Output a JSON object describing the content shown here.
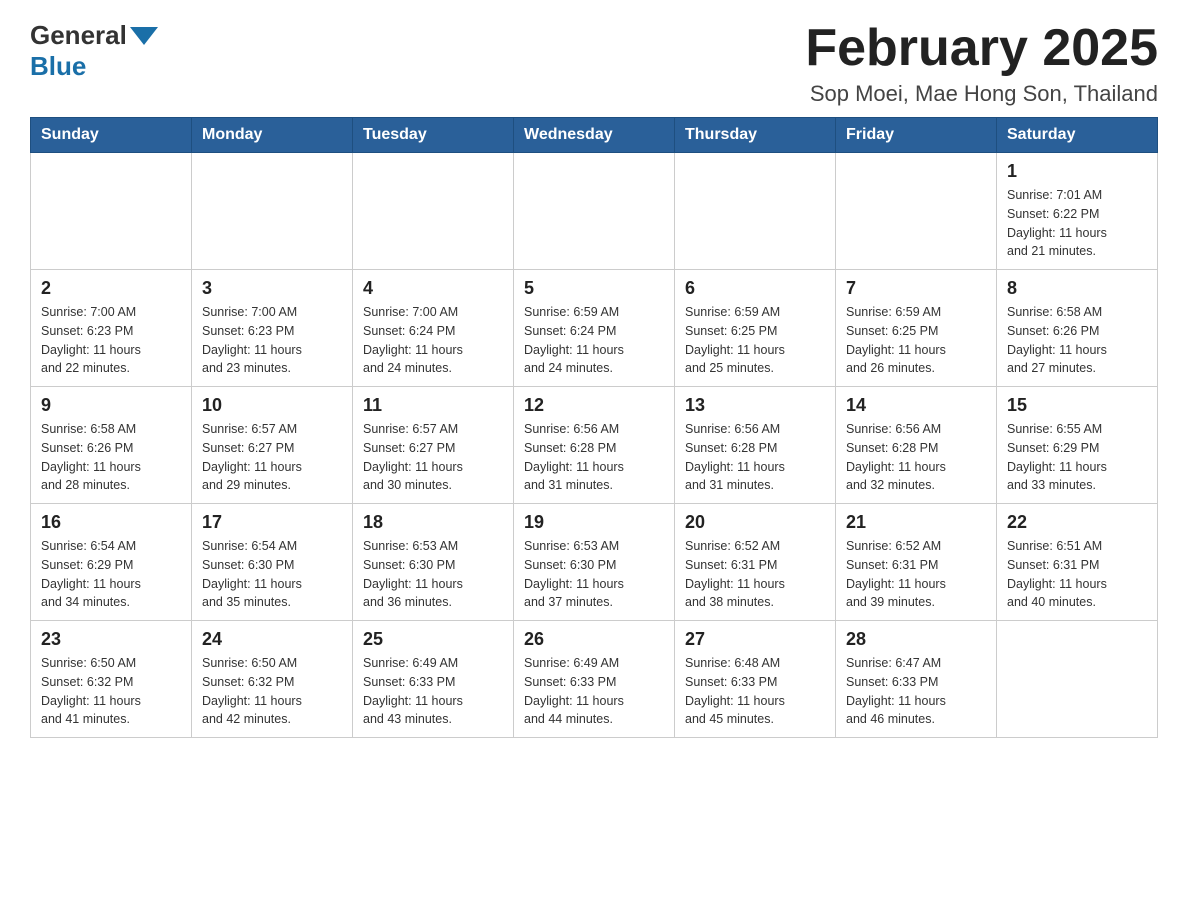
{
  "header": {
    "logo_general": "General",
    "logo_blue": "Blue",
    "month_title": "February 2025",
    "location": "Sop Moei, Mae Hong Son, Thailand"
  },
  "weekdays": [
    "Sunday",
    "Monday",
    "Tuesday",
    "Wednesday",
    "Thursday",
    "Friday",
    "Saturday"
  ],
  "weeks": [
    [
      {
        "day": "",
        "info": ""
      },
      {
        "day": "",
        "info": ""
      },
      {
        "day": "",
        "info": ""
      },
      {
        "day": "",
        "info": ""
      },
      {
        "day": "",
        "info": ""
      },
      {
        "day": "",
        "info": ""
      },
      {
        "day": "1",
        "info": "Sunrise: 7:01 AM\nSunset: 6:22 PM\nDaylight: 11 hours\nand 21 minutes."
      }
    ],
    [
      {
        "day": "2",
        "info": "Sunrise: 7:00 AM\nSunset: 6:23 PM\nDaylight: 11 hours\nand 22 minutes."
      },
      {
        "day": "3",
        "info": "Sunrise: 7:00 AM\nSunset: 6:23 PM\nDaylight: 11 hours\nand 23 minutes."
      },
      {
        "day": "4",
        "info": "Sunrise: 7:00 AM\nSunset: 6:24 PM\nDaylight: 11 hours\nand 24 minutes."
      },
      {
        "day": "5",
        "info": "Sunrise: 6:59 AM\nSunset: 6:24 PM\nDaylight: 11 hours\nand 24 minutes."
      },
      {
        "day": "6",
        "info": "Sunrise: 6:59 AM\nSunset: 6:25 PM\nDaylight: 11 hours\nand 25 minutes."
      },
      {
        "day": "7",
        "info": "Sunrise: 6:59 AM\nSunset: 6:25 PM\nDaylight: 11 hours\nand 26 minutes."
      },
      {
        "day": "8",
        "info": "Sunrise: 6:58 AM\nSunset: 6:26 PM\nDaylight: 11 hours\nand 27 minutes."
      }
    ],
    [
      {
        "day": "9",
        "info": "Sunrise: 6:58 AM\nSunset: 6:26 PM\nDaylight: 11 hours\nand 28 minutes."
      },
      {
        "day": "10",
        "info": "Sunrise: 6:57 AM\nSunset: 6:27 PM\nDaylight: 11 hours\nand 29 minutes."
      },
      {
        "day": "11",
        "info": "Sunrise: 6:57 AM\nSunset: 6:27 PM\nDaylight: 11 hours\nand 30 minutes."
      },
      {
        "day": "12",
        "info": "Sunrise: 6:56 AM\nSunset: 6:28 PM\nDaylight: 11 hours\nand 31 minutes."
      },
      {
        "day": "13",
        "info": "Sunrise: 6:56 AM\nSunset: 6:28 PM\nDaylight: 11 hours\nand 31 minutes."
      },
      {
        "day": "14",
        "info": "Sunrise: 6:56 AM\nSunset: 6:28 PM\nDaylight: 11 hours\nand 32 minutes."
      },
      {
        "day": "15",
        "info": "Sunrise: 6:55 AM\nSunset: 6:29 PM\nDaylight: 11 hours\nand 33 minutes."
      }
    ],
    [
      {
        "day": "16",
        "info": "Sunrise: 6:54 AM\nSunset: 6:29 PM\nDaylight: 11 hours\nand 34 minutes."
      },
      {
        "day": "17",
        "info": "Sunrise: 6:54 AM\nSunset: 6:30 PM\nDaylight: 11 hours\nand 35 minutes."
      },
      {
        "day": "18",
        "info": "Sunrise: 6:53 AM\nSunset: 6:30 PM\nDaylight: 11 hours\nand 36 minutes."
      },
      {
        "day": "19",
        "info": "Sunrise: 6:53 AM\nSunset: 6:30 PM\nDaylight: 11 hours\nand 37 minutes."
      },
      {
        "day": "20",
        "info": "Sunrise: 6:52 AM\nSunset: 6:31 PM\nDaylight: 11 hours\nand 38 minutes."
      },
      {
        "day": "21",
        "info": "Sunrise: 6:52 AM\nSunset: 6:31 PM\nDaylight: 11 hours\nand 39 minutes."
      },
      {
        "day": "22",
        "info": "Sunrise: 6:51 AM\nSunset: 6:31 PM\nDaylight: 11 hours\nand 40 minutes."
      }
    ],
    [
      {
        "day": "23",
        "info": "Sunrise: 6:50 AM\nSunset: 6:32 PM\nDaylight: 11 hours\nand 41 minutes."
      },
      {
        "day": "24",
        "info": "Sunrise: 6:50 AM\nSunset: 6:32 PM\nDaylight: 11 hours\nand 42 minutes."
      },
      {
        "day": "25",
        "info": "Sunrise: 6:49 AM\nSunset: 6:33 PM\nDaylight: 11 hours\nand 43 minutes."
      },
      {
        "day": "26",
        "info": "Sunrise: 6:49 AM\nSunset: 6:33 PM\nDaylight: 11 hours\nand 44 minutes."
      },
      {
        "day": "27",
        "info": "Sunrise: 6:48 AM\nSunset: 6:33 PM\nDaylight: 11 hours\nand 45 minutes."
      },
      {
        "day": "28",
        "info": "Sunrise: 6:47 AM\nSunset: 6:33 PM\nDaylight: 11 hours\nand 46 minutes."
      },
      {
        "day": "",
        "info": ""
      }
    ]
  ]
}
